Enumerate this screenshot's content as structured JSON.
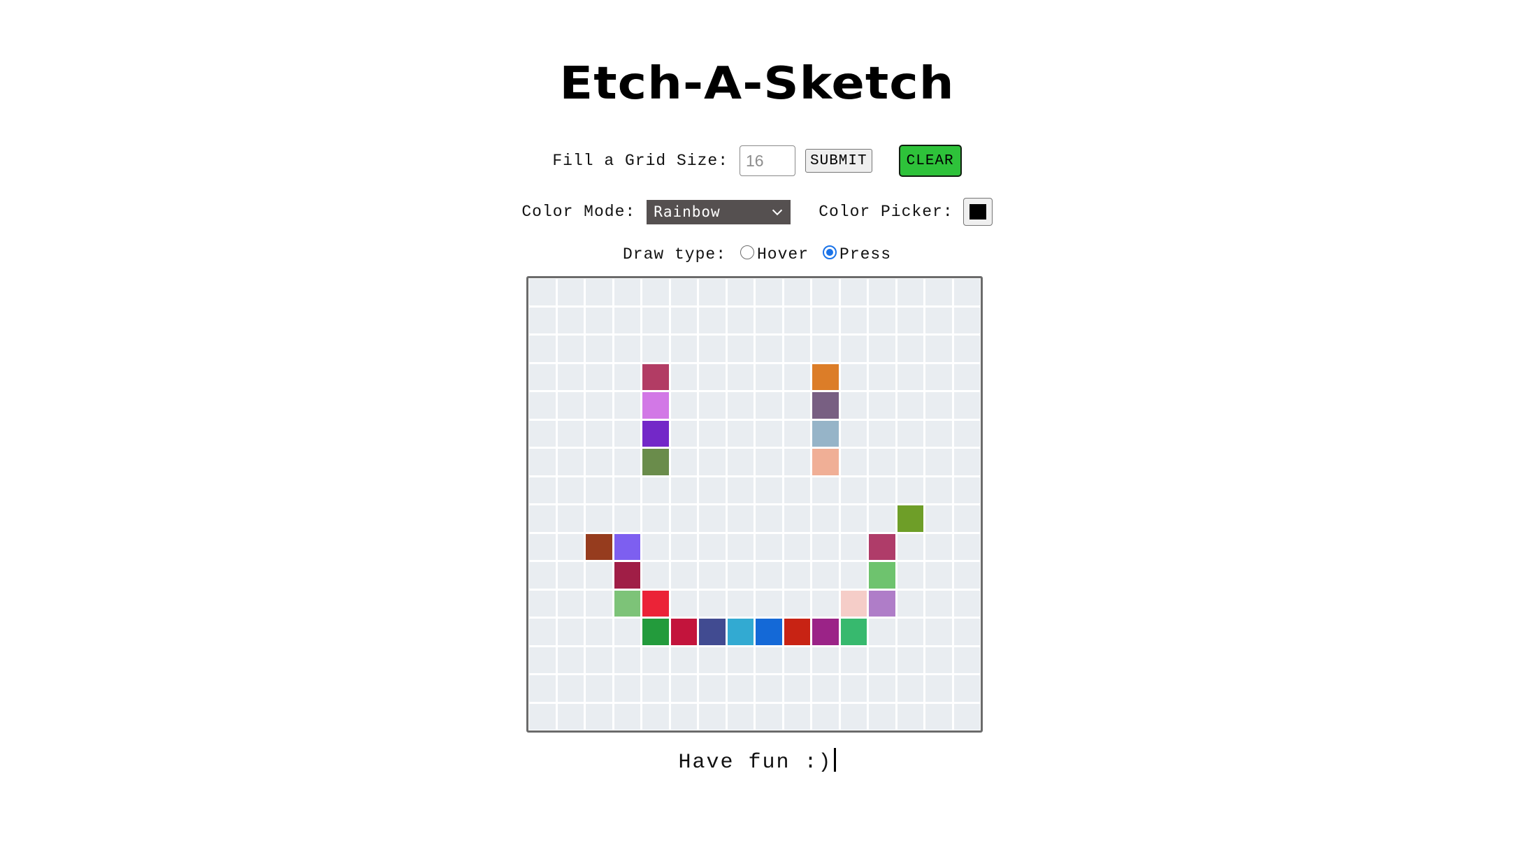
{
  "app": {
    "title": "Etch-A-Sketch"
  },
  "controls": {
    "grid_size_label": "Fill a Grid Size:",
    "grid_size_placeholder": "16",
    "submit_label": "SUBMIT",
    "clear_label": "CLEAR",
    "clear_color": "#2ec23a",
    "color_mode_label": "Color Mode:",
    "color_mode_value": "Rainbow",
    "color_picker_label": "Color Picker:",
    "color_picker_value": "#000000",
    "draw_type_label": "Draw type:",
    "draw_options": [
      {
        "label": "Hover",
        "checked": false
      },
      {
        "label": "Press",
        "checked": true
      }
    ]
  },
  "grid": {
    "size": 16,
    "empty_color": "#e9edf1",
    "painted": [
      {
        "row": 3,
        "col": 4,
        "color": "#b23c64"
      },
      {
        "row": 4,
        "col": 4,
        "color": "#d278e6"
      },
      {
        "row": 5,
        "col": 4,
        "color": "#7328c8"
      },
      {
        "row": 6,
        "col": 4,
        "color": "#6a8c4b"
      },
      {
        "row": 3,
        "col": 10,
        "color": "#dc7d28"
      },
      {
        "row": 4,
        "col": 10,
        "color": "#785f82"
      },
      {
        "row": 5,
        "col": 10,
        "color": "#96b4c8"
      },
      {
        "row": 6,
        "col": 10,
        "color": "#f0af96"
      },
      {
        "row": 8,
        "col": 13,
        "color": "#6e9e28"
      },
      {
        "row": 9,
        "col": 2,
        "color": "#963c1e"
      },
      {
        "row": 9,
        "col": 3,
        "color": "#7d5ff0"
      },
      {
        "row": 9,
        "col": 12,
        "color": "#af3c69"
      },
      {
        "row": 10,
        "col": 3,
        "color": "#a01e46"
      },
      {
        "row": 10,
        "col": 12,
        "color": "#6ec36e"
      },
      {
        "row": 11,
        "col": 3,
        "color": "#7dc378"
      },
      {
        "row": 11,
        "col": 4,
        "color": "#eb2337"
      },
      {
        "row": 11,
        "col": 11,
        "color": "#f5cdc8"
      },
      {
        "row": 11,
        "col": 12,
        "color": "#af7dc8"
      },
      {
        "row": 12,
        "col": 4,
        "color": "#239b3c"
      },
      {
        "row": 12,
        "col": 5,
        "color": "#c3143c"
      },
      {
        "row": 12,
        "col": 6,
        "color": "#414b91"
      },
      {
        "row": 12,
        "col": 7,
        "color": "#32aad2"
      },
      {
        "row": 12,
        "col": 8,
        "color": "#1469d7"
      },
      {
        "row": 12,
        "col": 9,
        "color": "#c82314"
      },
      {
        "row": 12,
        "col": 10,
        "color": "#9b2387"
      },
      {
        "row": 12,
        "col": 11,
        "color": "#37b96e"
      }
    ]
  },
  "footer": {
    "text": "Have fun :)"
  }
}
